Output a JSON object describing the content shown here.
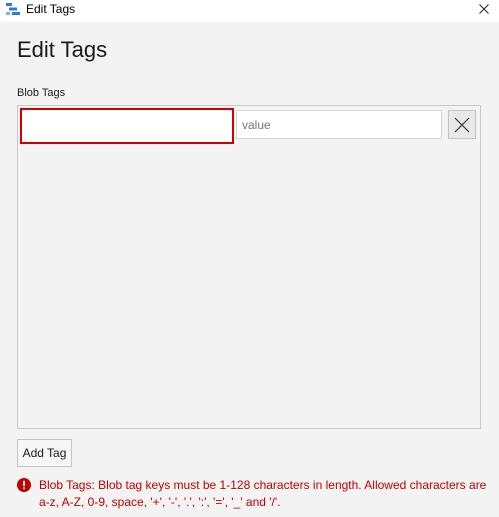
{
  "window": {
    "title": "Edit Tags",
    "icon": "storage-explorer-icon",
    "close_icon": "close-icon"
  },
  "dialog": {
    "heading": "Edit Tags",
    "section_label": "Blob Tags",
    "tags": [
      {
        "key_value": "",
        "key_placeholder": "",
        "value_value": "",
        "value_placeholder": "value",
        "remove_icon": "close-icon"
      }
    ],
    "add_tag_label": "Add Tag",
    "error": {
      "icon": "error-icon",
      "message": "Blob Tags: Blob tag keys must be 1-128 characters in length. Allowed characters are a-z, A-Z, 0-9, space, '+', '-', '.', ':', '=', '_' and '/'."
    }
  },
  "colors": {
    "error": "#c00000",
    "invalid_border": "#d10000",
    "body_background": "#f3f3f3",
    "icon_blue": "#2b7cd3"
  }
}
